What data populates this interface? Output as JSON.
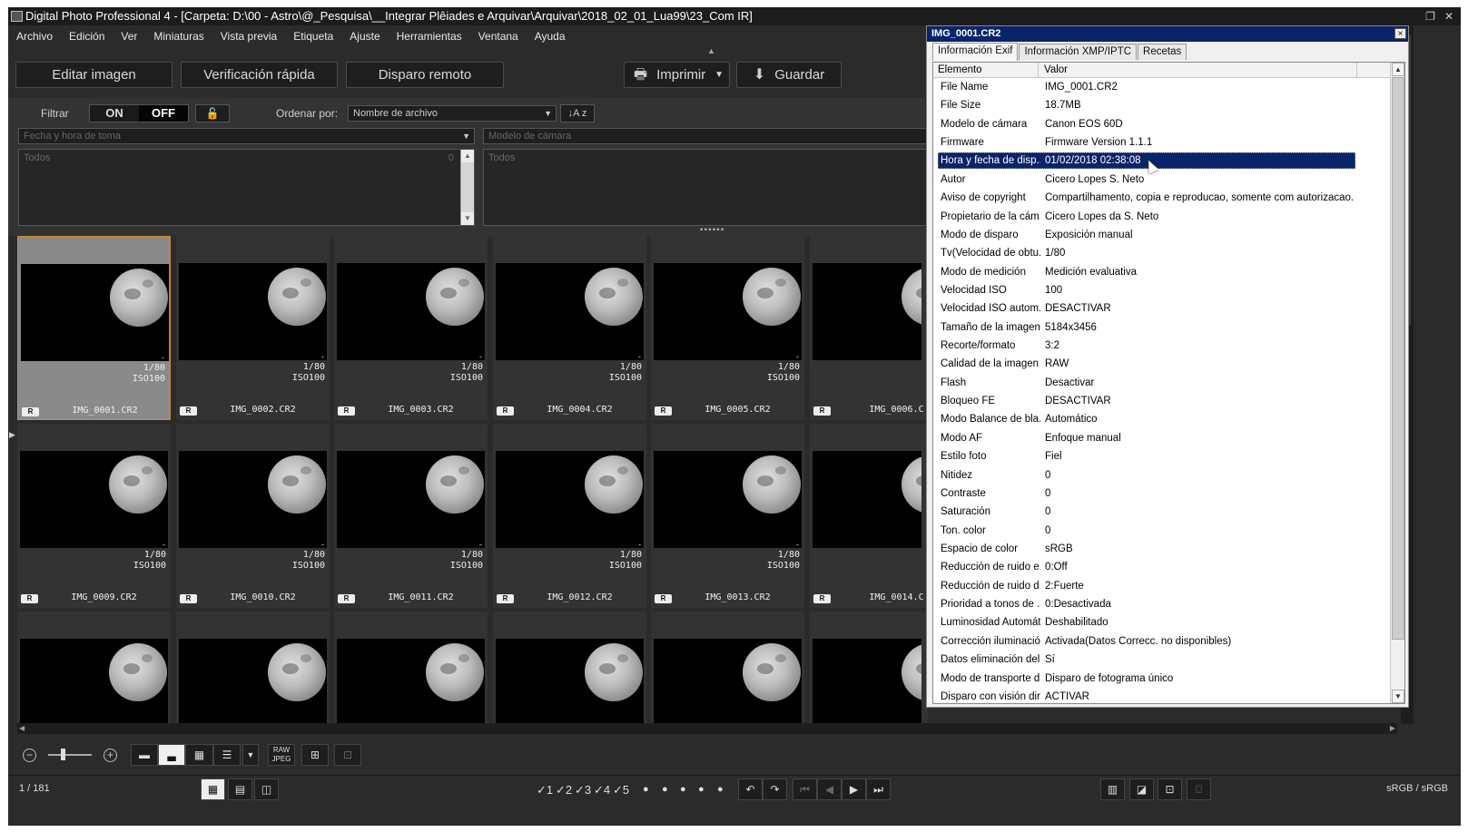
{
  "window": {
    "title": "Digital Photo Professional 4 - [Carpeta: D:\\00 - Astro\\@_Pesquisa\\__Integrar Plêiades e Arquivar\\Arquivar\\2018_02_01_Lua99\\23_Com IR]"
  },
  "menu": [
    "Archivo",
    "Edición",
    "Ver",
    "Miniaturas",
    "Vista previa",
    "Etiqueta",
    "Ajuste",
    "Herramientas",
    "Ventana",
    "Ayuda"
  ],
  "toolbar": {
    "edit_image": "Editar imagen",
    "quick_check": "Verificación rápida",
    "remote_shoot": "Disparo remoto",
    "print": "Imprimir",
    "save": "Guardar"
  },
  "filter": {
    "label": "Filtrar",
    "on": "ON",
    "off": "OFF",
    "sort_label": "Ordenar por:",
    "sort_value": "Nombre de archivo",
    "sort_btn": "↓A z",
    "date_field": "Fecha y hora de toma",
    "camera_field": "Modelo de cámara",
    "list1_all": "Todos",
    "list1_count": "0",
    "list2_all": "Todos"
  },
  "thumbnails": [
    {
      "name": "IMG_0001.CR2",
      "tv": "1/80",
      "iso": "ISO100",
      "badge": "R",
      "selected": true
    },
    {
      "name": "IMG_0002.CR2",
      "tv": "1/80",
      "iso": "ISO100",
      "badge": "R"
    },
    {
      "name": "IMG_0003.CR2",
      "tv": "1/80",
      "iso": "ISO100",
      "badge": "R"
    },
    {
      "name": "IMG_0004.CR2",
      "tv": "1/80",
      "iso": "ISO100",
      "badge": "R"
    },
    {
      "name": "IMG_0005.CR2",
      "tv": "1/80",
      "iso": "ISO100",
      "badge": "R"
    },
    {
      "name": "IMG_0006.C",
      "tv": "",
      "iso": "",
      "badge": "R",
      "partial": true
    },
    {
      "name": "IMG_0009.CR2",
      "tv": "1/80",
      "iso": "ISO100",
      "badge": "R"
    },
    {
      "name": "IMG_0010.CR2",
      "tv": "1/80",
      "iso": "ISO100",
      "badge": "R"
    },
    {
      "name": "IMG_0011.CR2",
      "tv": "1/80",
      "iso": "ISO100",
      "badge": "R"
    },
    {
      "name": "IMG_0012.CR2",
      "tv": "1/80",
      "iso": "ISO100",
      "badge": "R"
    },
    {
      "name": "IMG_0013.CR2",
      "tv": "1/80",
      "iso": "ISO100",
      "badge": "R"
    },
    {
      "name": "IMG_0014.C",
      "tv": "",
      "iso": "",
      "badge": "R",
      "partial": true
    },
    {
      "name": "",
      "tv": "",
      "iso": "",
      "badge": ""
    },
    {
      "name": "",
      "tv": "",
      "iso": "",
      "badge": ""
    },
    {
      "name": "",
      "tv": "",
      "iso": "",
      "badge": ""
    },
    {
      "name": "",
      "tv": "",
      "iso": "",
      "badge": ""
    },
    {
      "name": "",
      "tv": "",
      "iso": "",
      "badge": ""
    },
    {
      "name": "",
      "tv": "",
      "iso": "",
      "badge": "",
      "partial": true
    }
  ],
  "bottombar": {
    "raw_jpeg": "RAW JPEG"
  },
  "status": {
    "count": "1 / 181",
    "ratings": [
      "1",
      "2",
      "3",
      "4",
      "5"
    ],
    "color_space": "sRGB / sRGB"
  },
  "info": {
    "title": "IMG_0001.CR2",
    "close": "×",
    "tabs": [
      "Información Exif",
      "Información XMP/IPTC",
      "Recetas"
    ],
    "col_item": "Elemento",
    "col_value": "Valor",
    "rows": [
      {
        "k": "File Name",
        "v": "IMG_0001.CR2"
      },
      {
        "k": "File Size",
        "v": "18.7MB"
      },
      {
        "k": "Modelo de cámara",
        "v": "Canon EOS 60D"
      },
      {
        "k": "Firmware",
        "v": "Firmware Version 1.1.1"
      },
      {
        "k": "Hora y fecha de disp...",
        "v": "01/02/2018 02:38:08",
        "hl": true
      },
      {
        "k": "Autor",
        "v": "Cicero Lopes S. Neto"
      },
      {
        "k": "Aviso de copyright",
        "v": "Compartilhamento, copia e reproducao, somente com autorizacao."
      },
      {
        "k": "Propietario de la cám...",
        "v": "Cicero Lopes da S. Neto"
      },
      {
        "k": "Modo de disparo",
        "v": "Exposición manual"
      },
      {
        "k": "Tv(Velocidad de obtu...",
        "v": "1/80"
      },
      {
        "k": "Modo de medición",
        "v": "Medición evaluativa"
      },
      {
        "k": "Velocidad ISO",
        "v": "100"
      },
      {
        "k": "Velocidad ISO autom...",
        "v": "DESACTIVAR"
      },
      {
        "k": "Tamaño de la imagen",
        "v": "5184x3456"
      },
      {
        "k": "Recorte/formato",
        "v": "3:2"
      },
      {
        "k": "Calidad de la imagen",
        "v": "RAW"
      },
      {
        "k": "Flash",
        "v": "Desactivar"
      },
      {
        "k": "Bloqueo FE",
        "v": "DESACTIVAR"
      },
      {
        "k": "Modo Balance de bla...",
        "v": "Automático"
      },
      {
        "k": "Modo AF",
        "v": "Enfoque manual"
      },
      {
        "k": "Estilo foto",
        "v": "Fiel"
      },
      {
        "k": "Nitidez",
        "v": "0"
      },
      {
        "k": "Contraste",
        "v": "0"
      },
      {
        "k": "Saturación",
        "v": "0"
      },
      {
        "k": "Ton. color",
        "v": "0"
      },
      {
        "k": "Espacio de color",
        "v": "sRGB"
      },
      {
        "k": "Reducción de ruido e...",
        "v": "0:Off"
      },
      {
        "k": "Reducción de ruido d...",
        "v": "2:Fuerte"
      },
      {
        "k": "Prioridad a tonos de ...",
        "v": "0:Desactivada"
      },
      {
        "k": "Luminosidad Automát...",
        "v": "Deshabilitado"
      },
      {
        "k": "Corrección iluminació...",
        "v": "Activada(Datos Correcc. no disponibles)"
      },
      {
        "k": "Datos eliminación del...",
        "v": "Sí"
      },
      {
        "k": "Modo de transporte d...",
        "v": "Disparo de fotograma único"
      },
      {
        "k": "Disparo con visión dir...",
        "v": "ACTIVAR"
      }
    ]
  }
}
